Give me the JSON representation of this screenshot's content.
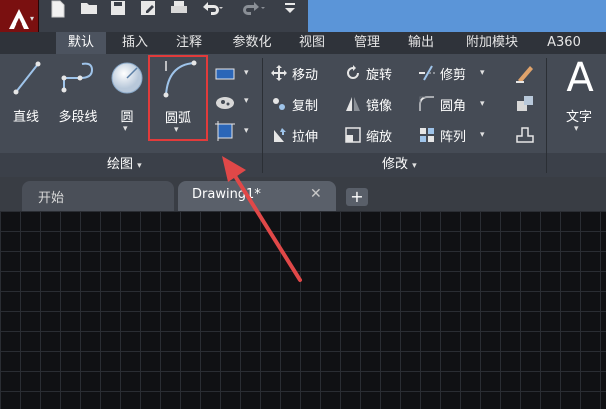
{
  "quick_access": {
    "icons": [
      "new-icon",
      "open-icon",
      "save-icon",
      "saveas-icon",
      "print-icon",
      "undo-icon",
      "redo-icon",
      "customize-icon"
    ]
  },
  "ribbon_tabs": [
    {
      "label": "默认",
      "active": true
    },
    {
      "label": "插入"
    },
    {
      "label": "注释"
    },
    {
      "label": "参数化"
    },
    {
      "label": "视图"
    },
    {
      "label": "管理"
    },
    {
      "label": "输出"
    },
    {
      "label": "附加模块"
    },
    {
      "label": "A360"
    }
  ],
  "draw_panel": {
    "title": "绘图",
    "tools": {
      "line": "直线",
      "polyline": "多段线",
      "circle": "圆",
      "arc": "圆弧"
    }
  },
  "modify_panel": {
    "title": "修改",
    "tools": {
      "move": "移动",
      "rotate": "旋转",
      "trim": "修剪",
      "copy": "复制",
      "mirror": "镜像",
      "fillet": "圆角",
      "stretch": "拉伸",
      "scale": "缩放",
      "array": "阵列"
    }
  },
  "annotation_panel": {
    "text_label": "文字"
  },
  "file_tabs": {
    "start": "开始",
    "drawing": "Drawing1*"
  },
  "colors": {
    "highlight": "#e23b3b",
    "arrow": "#e04848",
    "accent": "#5b95d8"
  }
}
